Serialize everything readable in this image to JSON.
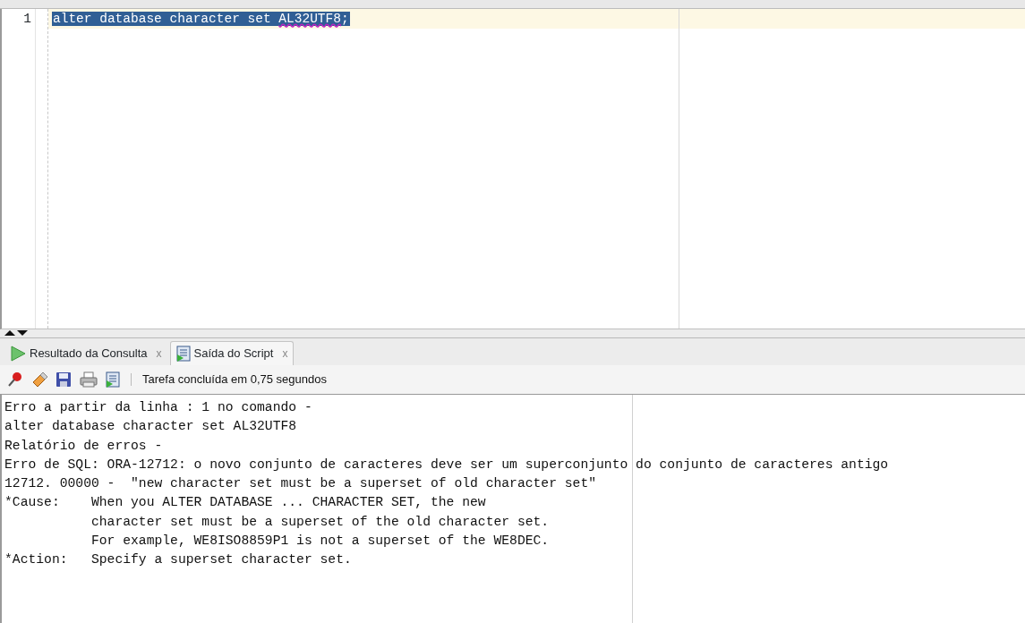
{
  "editor": {
    "lines": [
      {
        "number": "1",
        "selected": true,
        "current": true,
        "segments": [
          {
            "text": "alter database character set ",
            "flagged": false
          },
          {
            "text": "AL32UTF8",
            "flagged": true
          },
          {
            "text": ";",
            "flagged": false
          }
        ]
      }
    ]
  },
  "output_tabs": [
    {
      "label": "Resultado da Consulta",
      "kind": "run",
      "close": "x",
      "selected": false
    },
    {
      "label": "Saída do Script",
      "kind": "script",
      "close": "x",
      "selected": true
    }
  ],
  "toolbar": {
    "icons": [
      {
        "kind": "pin"
      },
      {
        "kind": "eraser"
      },
      {
        "kind": "save"
      },
      {
        "kind": "print"
      },
      {
        "kind": "script"
      }
    ],
    "status": "Tarefa concluída em 0,75 segundos"
  },
  "output": {
    "lines": [
      "Erro a partir da linha : 1 no comando -",
      "alter database character set AL32UTF8",
      "Relatório de erros -",
      "Erro de SQL: ORA-12712: o novo conjunto de caracteres deve ser um superconjunto do conjunto de caracteres antigo",
      "12712. 00000 -  \"new character set must be a superset of old character set\"",
      "*Cause:    When you ALTER DATABASE ... CHARACTER SET, the new",
      "           character set must be a superset of the old character set.",
      "           For example, WE8ISO8859P1 is not a superset of the WE8DEC.",
      "*Action:   Specify a superset character set."
    ]
  }
}
